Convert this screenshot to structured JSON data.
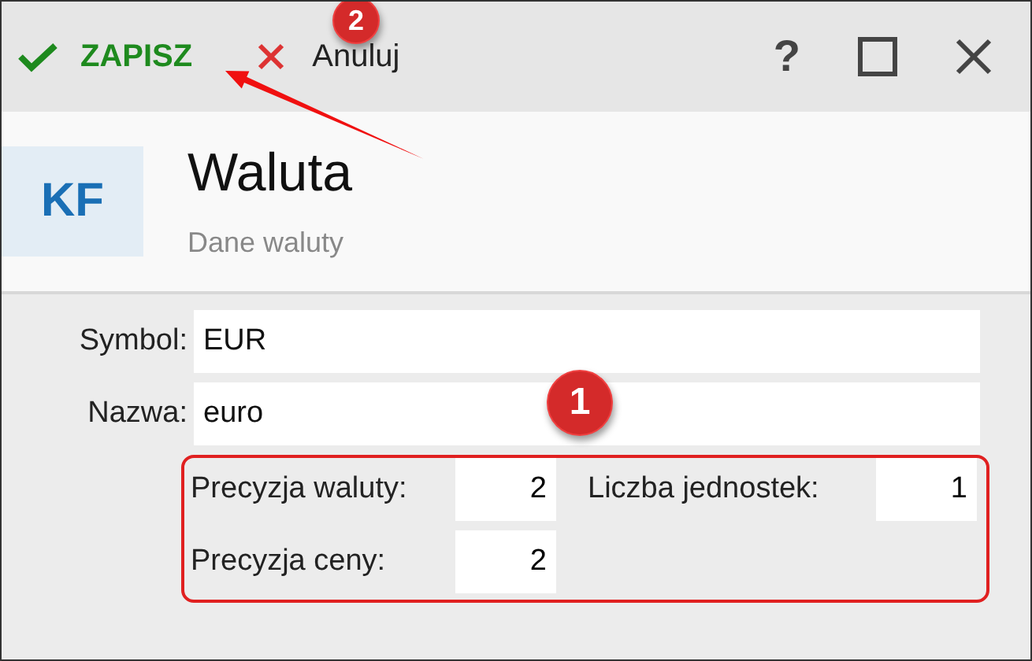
{
  "toolbar": {
    "save_button": "ZAPISZ",
    "cancel_button": "Anuluj",
    "help_button": "?"
  },
  "header": {
    "logo": "KF",
    "title": "Waluta",
    "subtitle": "Dane waluty"
  },
  "fields": [
    {
      "label": "Symbol:",
      "value": "EUR"
    },
    {
      "label": "Nazwa:",
      "value": "euro"
    }
  ],
  "precision_group": [
    {
      "label": "Precyzja waluty:",
      "value": "2"
    },
    {
      "label": "Liczba jednostek:",
      "value": "1"
    },
    {
      "label": "Precyzja ceny:",
      "value": "2"
    }
  ],
  "annotations": [
    {
      "number": "1"
    },
    {
      "number": "2"
    }
  ]
}
